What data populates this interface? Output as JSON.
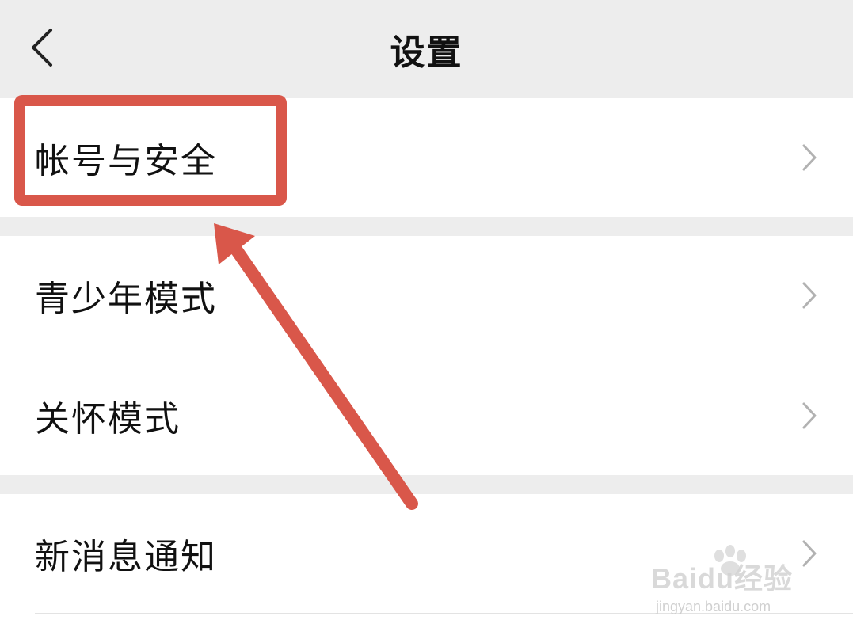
{
  "header": {
    "title": "设置",
    "back_icon": "chevron-left-icon"
  },
  "settings": {
    "items": [
      {
        "label": "帐号与安全",
        "chevron_icon": "chevron-right-icon"
      },
      {
        "label": "青少年模式",
        "chevron_icon": "chevron-right-icon"
      },
      {
        "label": "关怀模式",
        "chevron_icon": "chevron-right-icon"
      },
      {
        "label": "新消息通知",
        "chevron_icon": "chevron-right-icon"
      }
    ]
  },
  "annotation": {
    "color": "#d9574a",
    "highlighted_item": "帐号与安全"
  },
  "watermark": {
    "brand": "Baidu经验",
    "url": "jingyan.baidu.com"
  },
  "colors": {
    "background": "#ededed",
    "row_background": "#ffffff",
    "text": "#111111",
    "chevron": "#b2b2b2"
  }
}
